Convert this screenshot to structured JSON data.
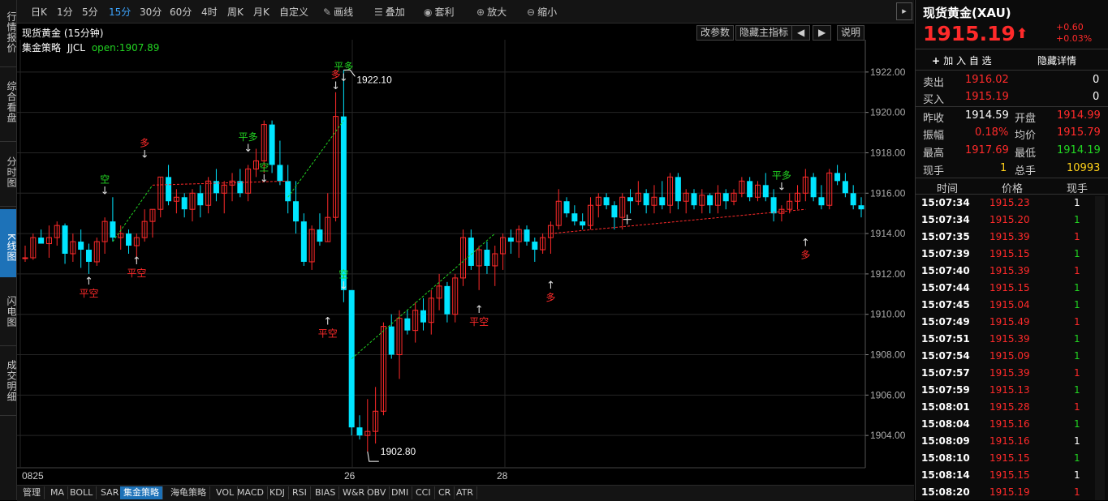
{
  "nav": {
    "items": [
      "行情报价",
      "综合看盘",
      "分时图",
      "K线图",
      "闪电图",
      "成交明细"
    ],
    "active": "K线图"
  },
  "toolbar": {
    "periods": [
      "日K",
      "1分",
      "5分",
      "15分",
      "30分",
      "60分",
      "4时",
      "周K",
      "月K",
      "自定义"
    ],
    "active_period": "15分",
    "tools": [
      "画线",
      "叠加",
      "套利",
      "放大",
      "缩小"
    ],
    "icons": [
      "pencil-icon",
      "stack-icon",
      "coin-bag-icon",
      "zoom-in-icon",
      "zoom-out-icon"
    ],
    "collapse": "▸"
  },
  "chart_header": {
    "title": "现货黄金 (15分钟)",
    "buttons": [
      "改参数",
      "隐藏主指标",
      "◀",
      "▶",
      "说明"
    ],
    "strategy_name": "集金策略",
    "strategy_code": "JJCL",
    "strategy_open": "open:1907.89"
  },
  "chart_data": {
    "type": "candlestick",
    "y_range": [
      1902.4,
      1923.6
    ],
    "y_ticks": [
      "1922.00",
      "1920.00",
      "1918.00",
      "1916.00",
      "1914.00",
      "1912.00",
      "1910.00",
      "1908.00",
      "1906.00",
      "1904.00"
    ],
    "x_labels": [
      "0825",
      "26",
      "28"
    ],
    "annotations": {
      "high": "1922.10",
      "low": "1902.80"
    },
    "signals": [
      "平空",
      "空",
      "平空",
      "多",
      "平多",
      "空",
      "多",
      "平多",
      "平空",
      "空",
      "平空",
      "多",
      "平多",
      "多"
    ],
    "candles": [
      [
        1912.8,
        1913.4,
        1912.6,
        1912.8
      ],
      [
        1912.8,
        1914.0,
        1912.7,
        1913.8
      ],
      [
        1913.8,
        1914.2,
        1913.6,
        1913.5
      ],
      [
        1913.5,
        1914.4,
        1912.8,
        1913.8
      ],
      [
        1913.8,
        1914.6,
        1913.4,
        1914.4
      ],
      [
        1914.4,
        1914.5,
        1912.5,
        1913.0
      ],
      [
        1913.0,
        1914.0,
        1912.6,
        1913.6
      ],
      [
        1913.6,
        1914.2,
        1912.3,
        1913.2
      ],
      [
        1913.2,
        1913.5,
        1912.0,
        1912.6
      ],
      [
        1912.6,
        1913.8,
        1912.4,
        1913.6
      ],
      [
        1913.6,
        1914.8,
        1913.0,
        1914.6
      ],
      [
        1914.6,
        1915.8,
        1913.6,
        1913.8
      ],
      [
        1913.8,
        1914.4,
        1913.2,
        1914.0
      ],
      [
        1914.0,
        1914.2,
        1913.0,
        1913.4
      ],
      [
        1913.4,
        1914.0,
        1912.6,
        1913.8
      ],
      [
        1913.8,
        1915.2,
        1913.6,
        1914.6
      ],
      [
        1914.6,
        1915.2,
        1913.8,
        1915.2
      ],
      [
        1915.2,
        1916.8,
        1914.8,
        1916.8
      ],
      [
        1916.8,
        1917.4,
        1915.4,
        1915.6
      ],
      [
        1915.6,
        1916.2,
        1915.0,
        1915.8
      ],
      [
        1915.8,
        1916.0,
        1914.8,
        1915.2
      ],
      [
        1915.2,
        1916.2,
        1914.6,
        1916.0
      ],
      [
        1916.0,
        1916.4,
        1914.8,
        1915.4
      ],
      [
        1915.4,
        1916.8,
        1915.0,
        1916.6
      ],
      [
        1916.6,
        1917.2,
        1915.6,
        1916.0
      ],
      [
        1916.0,
        1916.6,
        1915.0,
        1916.4
      ],
      [
        1916.4,
        1917.0,
        1915.6,
        1916.6
      ],
      [
        1916.6,
        1917.2,
        1915.8,
        1916.0
      ],
      [
        1916.0,
        1917.4,
        1915.6,
        1917.2
      ],
      [
        1917.2,
        1918.2,
        1916.8,
        1917.6
      ],
      [
        1917.6,
        1919.6,
        1917.0,
        1919.4
      ],
      [
        1919.4,
        1919.6,
        1917.0,
        1917.4
      ],
      [
        1917.4,
        1918.6,
        1916.4,
        1916.6
      ],
      [
        1916.6,
        1917.4,
        1915.0,
        1915.6
      ],
      [
        1915.6,
        1916.6,
        1914.0,
        1914.6
      ],
      [
        1914.6,
        1915.0,
        1912.4,
        1912.6
      ],
      [
        1912.6,
        1914.4,
        1912.2,
        1914.2
      ],
      [
        1914.2,
        1915.0,
        1913.4,
        1913.6
      ],
      [
        1913.6,
        1916.0,
        1913.6,
        1914.8
      ],
      [
        1914.8,
        1921.0,
        1914.6,
        1919.8
      ],
      [
        1919.8,
        1922.1,
        1910.6,
        1911.2
      ],
      [
        1911.2,
        1911.2,
        1904.0,
        1904.4
      ],
      [
        1904.4,
        1905.0,
        1903.8,
        1904.0
      ],
      [
        1904.0,
        1905.8,
        1903.2,
        1904.2
      ],
      [
        1904.2,
        1906.4,
        1903.6,
        1905.2
      ],
      [
        1905.2,
        1909.6,
        1905.0,
        1909.4
      ],
      [
        1909.4,
        1910.0,
        1907.8,
        1908.0
      ],
      [
        1908.0,
        1910.2,
        1906.8,
        1909.8
      ],
      [
        1909.8,
        1910.2,
        1909.0,
        1909.2
      ],
      [
        1909.2,
        1910.6,
        1908.6,
        1910.2
      ],
      [
        1910.2,
        1910.8,
        1909.2,
        1909.6
      ],
      [
        1909.6,
        1911.2,
        1909.0,
        1910.8
      ],
      [
        1910.8,
        1912.0,
        1910.2,
        1911.4
      ],
      [
        1911.4,
        1911.6,
        1909.6,
        1910.0
      ],
      [
        1910.0,
        1912.0,
        1909.6,
        1911.8
      ],
      [
        1911.8,
        1914.2,
        1911.4,
        1913.8
      ],
      [
        1913.8,
        1914.2,
        1912.2,
        1912.4
      ],
      [
        1912.4,
        1913.4,
        1911.2,
        1913.2
      ],
      [
        1913.2,
        1913.6,
        1912.0,
        1912.4
      ],
      [
        1912.4,
        1913.4,
        1911.4,
        1913.0
      ],
      [
        1913.0,
        1914.0,
        1912.2,
        1913.8
      ],
      [
        1913.8,
        1914.2,
        1913.0,
        1913.6
      ],
      [
        1913.6,
        1914.4,
        1912.8,
        1914.2
      ],
      [
        1914.2,
        1914.4,
        1913.4,
        1913.6
      ],
      [
        1913.6,
        1913.8,
        1912.6,
        1913.2
      ],
      [
        1913.2,
        1914.0,
        1913.0,
        1913.8
      ],
      [
        1913.8,
        1914.6,
        1913.0,
        1914.4
      ],
      [
        1914.4,
        1916.2,
        1914.2,
        1915.6
      ],
      [
        1915.6,
        1915.8,
        1914.8,
        1915.0
      ],
      [
        1915.0,
        1915.4,
        1914.4,
        1914.6
      ],
      [
        1914.6,
        1915.0,
        1914.2,
        1914.4
      ],
      [
        1914.4,
        1915.8,
        1914.2,
        1915.4
      ],
      [
        1915.4,
        1916.0,
        1914.8,
        1915.8
      ],
      [
        1915.8,
        1916.0,
        1915.2,
        1915.4
      ],
      [
        1915.4,
        1915.6,
        1914.2,
        1914.8
      ],
      [
        1914.8,
        1916.0,
        1914.2,
        1915.8
      ],
      [
        1915.8,
        1916.2,
        1915.0,
        1915.6
      ],
      [
        1915.6,
        1916.6,
        1915.4,
        1916.0
      ],
      [
        1916.0,
        1916.2,
        1915.0,
        1915.4
      ],
      [
        1915.4,
        1916.4,
        1915.0,
        1915.8
      ],
      [
        1915.8,
        1916.6,
        1915.2,
        1915.4
      ],
      [
        1915.4,
        1917.0,
        1915.0,
        1916.8
      ],
      [
        1916.8,
        1917.0,
        1915.2,
        1915.6
      ],
      [
        1915.6,
        1916.2,
        1915.0,
        1916.0
      ],
      [
        1916.0,
        1916.2,
        1915.2,
        1915.4
      ],
      [
        1915.4,
        1916.2,
        1915.0,
        1915.9
      ],
      [
        1915.9,
        1916.0,
        1915.0,
        1915.4
      ],
      [
        1915.4,
        1916.4,
        1915.0,
        1916.0
      ],
      [
        1916.0,
        1916.2,
        1915.2,
        1915.6
      ],
      [
        1915.6,
        1916.2,
        1915.4,
        1916.0
      ],
      [
        1916.0,
        1916.8,
        1915.8,
        1916.6
      ],
      [
        1916.6,
        1916.8,
        1915.6,
        1915.8
      ],
      [
        1915.8,
        1916.6,
        1915.6,
        1916.4
      ],
      [
        1916.4,
        1917.0,
        1915.6,
        1915.8
      ],
      [
        1915.8,
        1916.2,
        1914.6,
        1915.0
      ],
      [
        1915.0,
        1915.4,
        1914.6,
        1915.2
      ],
      [
        1915.2,
        1916.0,
        1915.0,
        1915.6
      ],
      [
        1915.6,
        1916.4,
        1915.2,
        1916.0
      ],
      [
        1916.0,
        1917.2,
        1915.6,
        1916.8
      ],
      [
        1916.8,
        1917.0,
        1915.6,
        1915.8
      ],
      [
        1915.8,
        1916.4,
        1915.2,
        1915.4
      ],
      [
        1915.4,
        1917.2,
        1915.2,
        1917.0
      ],
      [
        1917.0,
        1917.4,
        1916.4,
        1916.6
      ],
      [
        1916.6,
        1917.0,
        1915.8,
        1916.0
      ],
      [
        1916.0,
        1916.4,
        1915.2,
        1915.4
      ],
      [
        1915.4,
        1915.8,
        1914.8,
        1915.2
      ]
    ]
  },
  "quote": {
    "title": "现货黄金(XAU)",
    "price": "1915.19",
    "arrow": "⬆",
    "change": "+0.60",
    "change_pct": "+0.03%",
    "add_watch": "加 入 自 选",
    "hide_detail": "隐藏详情",
    "sell_label": "卖出",
    "sell_price": "1916.02",
    "sell_vol": "0",
    "buy_label": "买入",
    "buy_price": "1915.19",
    "buy_vol": "0",
    "prev_close_label": "昨收",
    "prev_close": "1914.59",
    "open_label": "开盘",
    "open": "1914.99",
    "amp_label": "振幅",
    "amp": "0.18%",
    "avg_label": "均价",
    "avg": "1915.79",
    "high_label": "最高",
    "high": "1917.69",
    "low_label": "最低",
    "low": "1914.19",
    "cur_vol_label": "现手",
    "cur_vol": "1",
    "total_vol_label": "总手",
    "total_vol": "10993"
  },
  "ticks": {
    "headers": [
      "时间",
      "价格",
      "现手"
    ],
    "rows": [
      {
        "time": "15:07:34",
        "price": "1915.23",
        "vol": "1",
        "c": "white"
      },
      {
        "time": "15:07:34",
        "price": "1915.20",
        "vol": "1",
        "c": "green"
      },
      {
        "time": "15:07:35",
        "price": "1915.39",
        "vol": "1",
        "c": "red"
      },
      {
        "time": "15:07:39",
        "price": "1915.15",
        "vol": "1",
        "c": "green"
      },
      {
        "time": "15:07:40",
        "price": "1915.39",
        "vol": "1",
        "c": "red"
      },
      {
        "time": "15:07:44",
        "price": "1915.15",
        "vol": "1",
        "c": "green"
      },
      {
        "time": "15:07:45",
        "price": "1915.04",
        "vol": "1",
        "c": "green"
      },
      {
        "time": "15:07:49",
        "price": "1915.49",
        "vol": "1",
        "c": "red"
      },
      {
        "time": "15:07:51",
        "price": "1915.39",
        "vol": "1",
        "c": "green"
      },
      {
        "time": "15:07:54",
        "price": "1915.09",
        "vol": "1",
        "c": "green"
      },
      {
        "time": "15:07:57",
        "price": "1915.39",
        "vol": "1",
        "c": "red"
      },
      {
        "time": "15:07:59",
        "price": "1915.13",
        "vol": "1",
        "c": "green"
      },
      {
        "time": "15:08:01",
        "price": "1915.28",
        "vol": "1",
        "c": "red"
      },
      {
        "time": "15:08:04",
        "price": "1915.16",
        "vol": "1",
        "c": "green"
      },
      {
        "time": "15:08:09",
        "price": "1915.16",
        "vol": "1",
        "c": "white"
      },
      {
        "time": "15:08:10",
        "price": "1915.15",
        "vol": "1",
        "c": "green"
      },
      {
        "time": "15:08:14",
        "price": "1915.15",
        "vol": "1",
        "c": "white"
      },
      {
        "time": "15:08:20",
        "price": "1915.19",
        "vol": "1",
        "c": "red"
      }
    ]
  },
  "indicators": [
    "管理",
    "MA",
    "BOLL",
    "SAR",
    "集金策略",
    "海龟策略",
    "VOL",
    "MACD",
    "KDJ",
    "RSI",
    "BIAS",
    "W&R",
    "OBV",
    "DMI",
    "CCI",
    "CR",
    "ATR"
  ],
  "active_indicator": "集金策略",
  "colors": {
    "up": "#ff2a2a",
    "down": "#00e5ff",
    "green": "#22d422",
    "accent": "#1d72b8"
  }
}
